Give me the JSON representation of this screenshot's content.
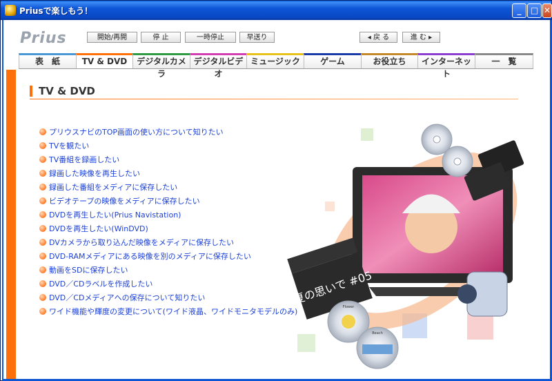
{
  "window": {
    "title": "Priusで楽しもう！"
  },
  "window_controls": {
    "minimize": "_",
    "maximize": "□",
    "close": "✕"
  },
  "logo": {
    "text": "Prius"
  },
  "controls": {
    "play_pause": "開始/再開",
    "stop": "停 止",
    "pause": "一時停止",
    "fast_forward": "早送り",
    "back": "◂ 戻 る",
    "forward": "進 む ▸"
  },
  "tabs": [
    {
      "label": "表　紙",
      "color": "#4a97d6"
    },
    {
      "label": "TV & DVD",
      "color": "#ff6f0a"
    },
    {
      "label": "デジタルカメラ",
      "color": "#2e9b43"
    },
    {
      "label": "デジタルビデオ",
      "color": "#d13fb2"
    },
    {
      "label": "ミュージック",
      "color": "#e6c21a"
    },
    {
      "label": "ゲーム",
      "color": "#1a3aa8"
    },
    {
      "label": "お役立ち",
      "color": "#c48a2a"
    },
    {
      "label": "インターネット",
      "color": "#8b3fd1"
    },
    {
      "label": "一　覧",
      "color": "#8a8a8a"
    }
  ],
  "active_tab": "TV & DVD",
  "page_title": "TV & DVD",
  "links": [
    "プリウスナビのTOP画面の使い方について知りたい",
    "TVを観たい",
    "TV番組を録画したい",
    "録画した映像を再生したい",
    "録画した番組をメディアに保存したい",
    "ビデオテープの映像をメディアに保存したい",
    "DVDを再生したい(Prius Navistation)",
    "DVDを再生したい(WinDVD)",
    "DVカメラから取り込んだ映像をメディアに保存したい",
    "DVD-RAMメディアにある映像を別のメディアに保存したい",
    "動画をSDに保存したい",
    "DVD／CDラベルを作成したい",
    "DVD／CDメディアへの保存について知りたい",
    "ワイド機能や輝度の変更について(ワイド液晶、ワイドモニタモデルのみ)"
  ],
  "hero": {
    "clapper_text": "夏の思いで #05",
    "disc_label_1": "Flower",
    "disc_label_2": "Beach"
  },
  "accent_color": "#ff6f0a",
  "link_color": "#1a3fd8"
}
